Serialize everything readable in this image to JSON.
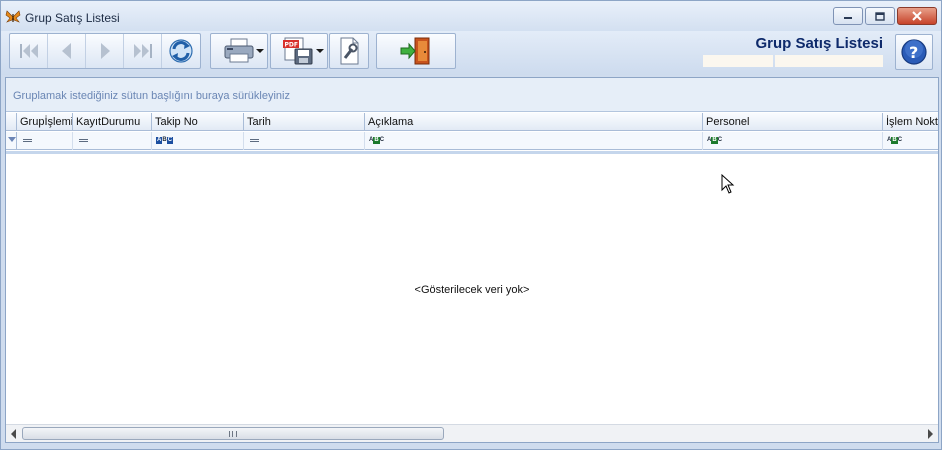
{
  "window": {
    "title": "Grup Satış Listesi",
    "buttons": [
      "minimize",
      "maximize",
      "close"
    ]
  },
  "toolbar": {
    "nav_buttons": [
      "first-icon",
      "previous-icon",
      "next-icon",
      "last-icon",
      "refresh-icon"
    ],
    "print_icon": "printer-icon",
    "export_icon": "pdf-save-icon",
    "settings_icon": "wrench-icon",
    "exit_icon": "exit-door-icon"
  },
  "header": {
    "title": "Grup Satış Listesi",
    "help_icon": "help-icon"
  },
  "grid": {
    "group_panel_text": "Gruplamak istediğiniz sütun başlığını buraya sürükleyiniz",
    "columns": [
      {
        "label": "Grupİşlemi",
        "filter": "equals"
      },
      {
        "label": "KayıtDurumu",
        "filter": "equals"
      },
      {
        "label": "Takip No",
        "filter": "abc-blue"
      },
      {
        "label": "Tarih",
        "filter": "equals"
      },
      {
        "label": "Açıklama",
        "filter": "abc-green"
      },
      {
        "label": "Personel",
        "filter": "abc-green"
      },
      {
        "label": "İşlem Noktası",
        "filter": "abc-green"
      }
    ],
    "empty_text": "<Gösterilecek veri yok>"
  },
  "colors": {
    "accent_title": "#0e2a6b",
    "group_text": "#6a86b4",
    "panel_bg": "#cfdcee"
  }
}
